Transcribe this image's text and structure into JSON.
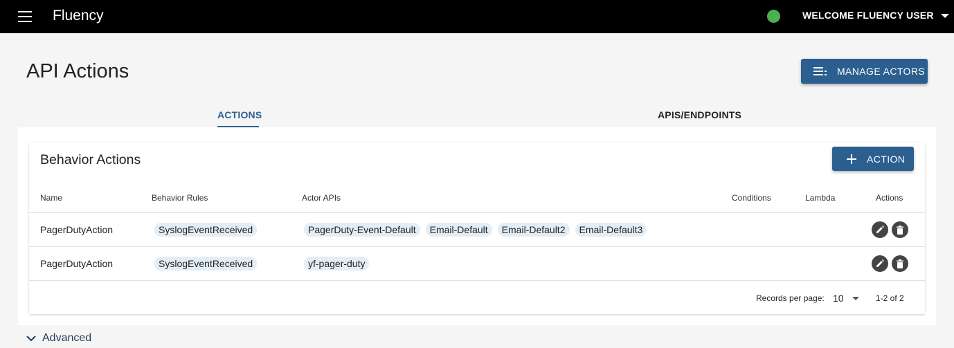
{
  "app": {
    "title": "Fluency",
    "user_menu": "WELCOME FLUENCY USER",
    "status_color": "#4caf50"
  },
  "page": {
    "title": "API Actions",
    "manage_actors_label": "MANAGE ACTORS"
  },
  "tabs": [
    {
      "label": "ACTIONS",
      "active": true
    },
    {
      "label": "APIS/ENDPOINTS",
      "active": false
    }
  ],
  "card": {
    "title": "Behavior Actions",
    "add_action_label": "ACTION",
    "columns": {
      "name": "Name",
      "rules": "Behavior Rules",
      "apis": "Actor APIs",
      "conditions": "Conditions",
      "lambda": "Lambda",
      "actions": "Actions"
    },
    "rows": [
      {
        "name": "PagerDutyAction",
        "rules": [
          "SyslogEventReceived"
        ],
        "apis": [
          "PagerDuty-Event-Default",
          "Email-Default",
          "Email-Default2",
          "Email-Default3"
        ]
      },
      {
        "name": "PagerDutyAction",
        "rules": [
          "SyslogEventReceived"
        ],
        "apis": [
          "yf-pager-duty"
        ]
      }
    ],
    "pagination": {
      "records_label": "Records per page:",
      "per_page": "10",
      "range": "1-2 of 2"
    }
  },
  "advanced": {
    "label": "Advanced"
  },
  "colors": {
    "primary": "#2b5f8f",
    "chip_bg": "#e3edf5",
    "topbar": "#000000"
  },
  "icons": {
    "menu": "menu-icon",
    "status": "status-dot-icon",
    "manage": "list-icon",
    "add": "plus-icon",
    "edit": "pencil-icon",
    "delete": "trash-icon",
    "expand": "chevron-down-icon"
  }
}
